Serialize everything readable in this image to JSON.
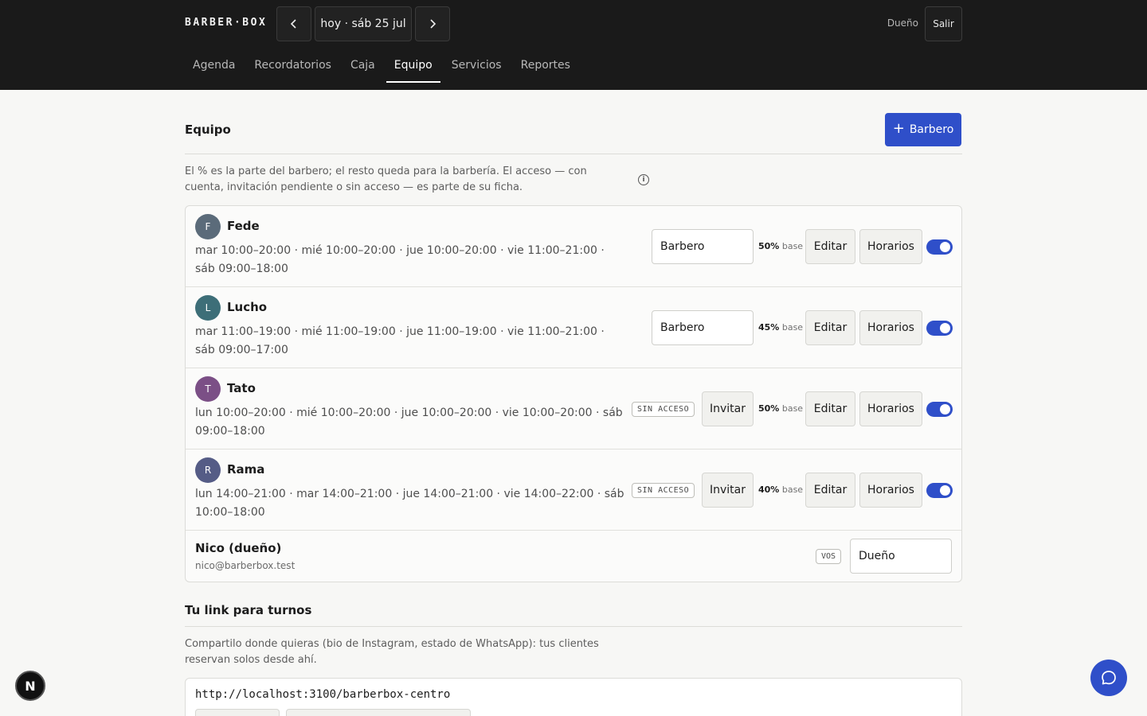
{
  "header": {
    "brand": "BARBER·BOX",
    "date_label": "hoy · sáb 25 jul",
    "role_label": "Dueño",
    "logout_label": "Salir"
  },
  "tabs": [
    {
      "label": "Agenda",
      "active": false
    },
    {
      "label": "Recordatorios",
      "active": false
    },
    {
      "label": "Caja",
      "active": false
    },
    {
      "label": "Equipo",
      "active": true
    },
    {
      "label": "Servicios",
      "active": false
    },
    {
      "label": "Reportes",
      "active": false
    }
  ],
  "team": {
    "title": "Equipo",
    "add_label": "Barbero",
    "note": "El % es la parte del barbero; el resto queda para la barbería. El acceso — con cuenta, invitación pendiente o sin acceso — es parte de su ficha.",
    "edit_label": "Editar",
    "hours_label": "Horarios",
    "invite_label": "Invitar",
    "no_access_label": "SIN ACCESO",
    "base_label": "base",
    "barbers": [
      {
        "initial": "F",
        "name": "Fede",
        "schedule": "mar 10:00–20:00 · mié 10:00–20:00 · jue 10:00–20:00 · vie 11:00–21:00 · sáb 09:00–18:00",
        "role": "Barbero",
        "pct": "50%",
        "no_access": false,
        "active": true,
        "avatar_color": "#5b6b7a"
      },
      {
        "initial": "L",
        "name": "Lucho",
        "schedule": "mar 11:00–19:00 · mié 11:00–19:00 · jue 11:00–19:00 · vie 11:00–21:00 · sáb 09:00–17:00",
        "role": "Barbero",
        "pct": "45%",
        "no_access": false,
        "active": true,
        "avatar_color": "#3d6e78"
      },
      {
        "initial": "T",
        "name": "Tato",
        "schedule": "lun 10:00–20:00 · mié 10:00–20:00 · jue 10:00–20:00 · vie 10:00–20:00 · sáb 09:00–18:00",
        "role": "",
        "pct": "50%",
        "no_access": true,
        "active": true,
        "avatar_color": "#7b4f86"
      },
      {
        "initial": "R",
        "name": "Rama",
        "schedule": "lun 14:00–21:00 · mar 14:00–21:00 · jue 14:00–21:00 · vie 14:00–22:00 · sáb 10:00–18:00",
        "role": "",
        "pct": "40%",
        "no_access": true,
        "active": true,
        "avatar_color": "#555c86"
      }
    ],
    "owner": {
      "name": "Nico (dueño)",
      "email": "nico@barberbox.test",
      "you_badge": "VOS",
      "role": "Dueño"
    }
  },
  "booking_link": {
    "title": "Tu link para turnos",
    "note": "Compartilo donde quieras (bio de Instagram, estado de WhatsApp): tus clientes reservan solos desde ahí.",
    "url": "http://localhost:3100/barberbox-centro"
  },
  "colors": {
    "accent": "#2f4fc9",
    "header_bg": "#1a1a1a"
  }
}
